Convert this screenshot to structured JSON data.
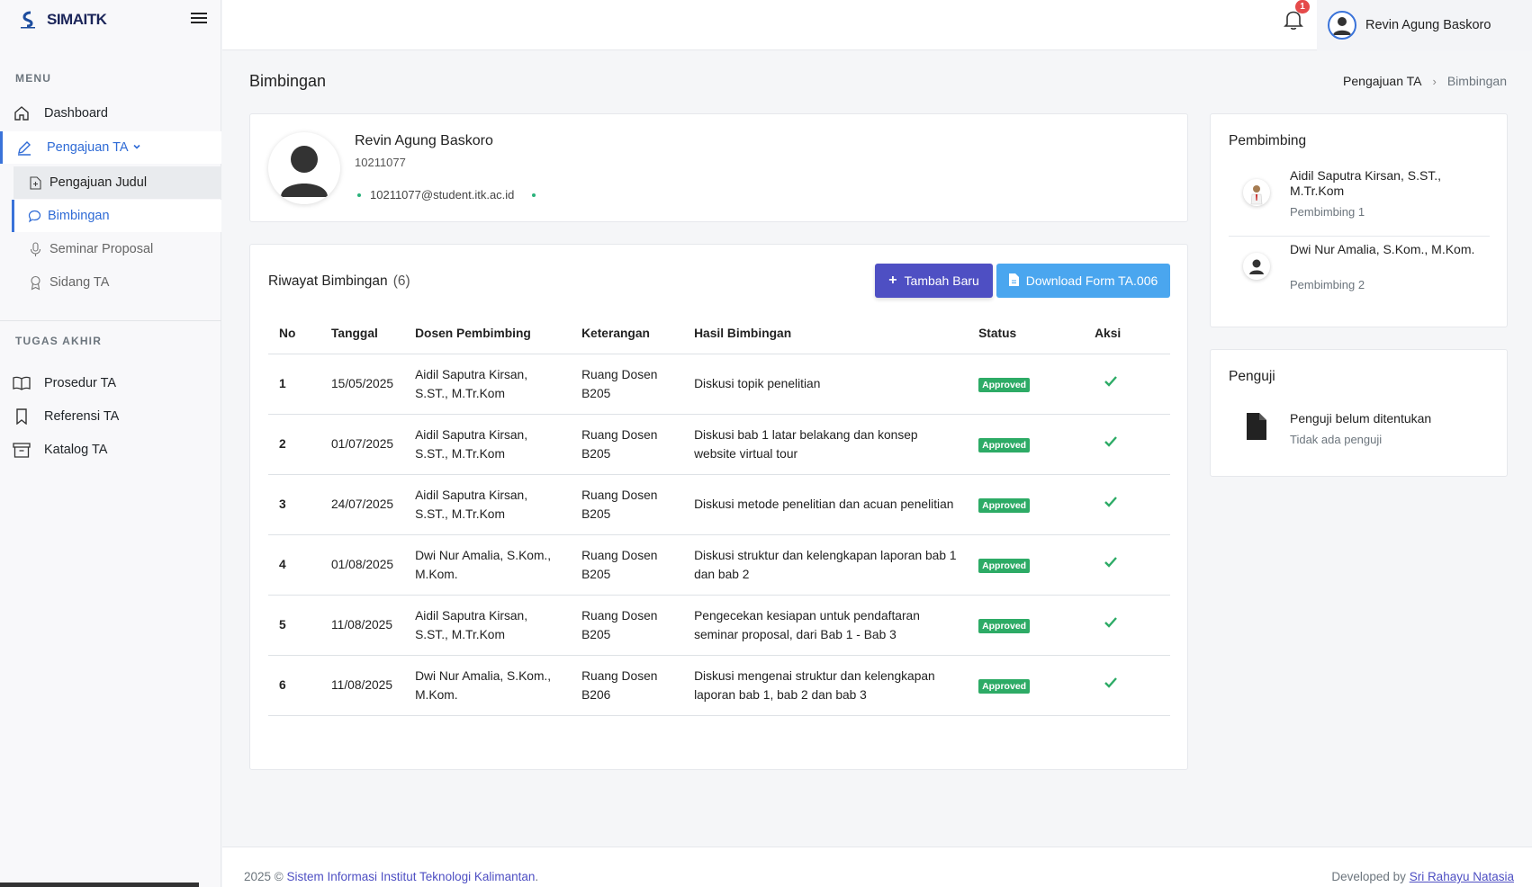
{
  "brand": {
    "name_prefix": "SIMA",
    "name_suffix": "ITK"
  },
  "sidebar": {
    "menu_title": "MENU",
    "items": [
      {
        "label": "Dashboard"
      },
      {
        "label": "Pengajuan TA"
      },
      {
        "label": "Pengajuan Judul"
      },
      {
        "label": "Bimbingan"
      },
      {
        "label": "Seminar Proposal"
      },
      {
        "label": "Sidang TA"
      }
    ],
    "section2_title": "TUGAS AKHIR",
    "items2": [
      {
        "label": "Prosedur TA"
      },
      {
        "label": "Referensi TA"
      },
      {
        "label": "Katalog TA"
      }
    ]
  },
  "topbar": {
    "notification_count": "1",
    "user_name": "Revin Agung Baskoro"
  },
  "page": {
    "title": "Bimbingan",
    "breadcrumb": [
      "Pengajuan TA",
      "Bimbingan"
    ]
  },
  "profile": {
    "name": "Revin Agung Baskoro",
    "nim": "10211077",
    "email": "10211077@student.itk.ac.id"
  },
  "history": {
    "title": "Riwayat Bimbingan",
    "count": "(6)",
    "add_button": "Tambah Baru",
    "download_button": "Download Form TA.006",
    "columns": [
      "No",
      "Tanggal",
      "Dosen Pembimbing",
      "Keterangan",
      "Hasil Bimbingan",
      "Status",
      "Aksi"
    ],
    "rows": [
      {
        "no": "1",
        "tanggal": "15/05/2025",
        "dosen": "Aidil Saputra Kirsan, S.ST., M.Tr.Kom",
        "keterangan": "Ruang Dosen B205",
        "hasil": "Diskusi topik penelitian",
        "status": "Approved"
      },
      {
        "no": "2",
        "tanggal": "01/07/2025",
        "dosen": "Aidil Saputra Kirsan, S.ST., M.Tr.Kom",
        "keterangan": "Ruang Dosen B205",
        "hasil": "Diskusi bab 1 latar belakang dan konsep website virtual tour",
        "status": "Approved"
      },
      {
        "no": "3",
        "tanggal": "24/07/2025",
        "dosen": "Aidil Saputra Kirsan, S.ST., M.Tr.Kom",
        "keterangan": "Ruang Dosen B205",
        "hasil": "Diskusi metode penelitian dan acuan penelitian",
        "status": "Approved"
      },
      {
        "no": "4",
        "tanggal": "01/08/2025",
        "dosen": "Dwi Nur Amalia, S.Kom., M.Kom.",
        "keterangan": "Ruang Dosen B205",
        "hasil": "Diskusi struktur dan kelengkapan laporan bab 1 dan bab 2",
        "status": "Approved"
      },
      {
        "no": "5",
        "tanggal": "11/08/2025",
        "dosen": "Aidil Saputra Kirsan, S.ST., M.Tr.Kom",
        "keterangan": "Ruang Dosen B205",
        "hasil": "Pengecekan kesiapan untuk pendaftaran seminar proposal, dari Bab 1 - Bab 3",
        "status": "Approved"
      },
      {
        "no": "6",
        "tanggal": "11/08/2025",
        "dosen": "Dwi Nur Amalia, S.Kom., M.Kom.",
        "keterangan": "Ruang Dosen B206",
        "hasil": "Diskusi mengenai struktur dan kelengkapan laporan bab 1, bab 2 dan bab 3",
        "status": "Approved"
      }
    ]
  },
  "pembimbing": {
    "title": "Pembimbing",
    "items": [
      {
        "name": "Aidil Saputra Kirsan, S.ST., M.Tr.Kom",
        "role": "Pembimbing 1"
      },
      {
        "name": "Dwi Nur Amalia, S.Kom., M.Kom.",
        "role": "Pembimbing 2"
      }
    ]
  },
  "penguji": {
    "title": "Penguji",
    "name": "Penguji belum ditentukan",
    "note": "Tidak ada penguji"
  },
  "footer": {
    "year": "2025 ©",
    "institution": "Sistem Informasi Institut Teknologi Kalimantan",
    "developed_by": "Developed by",
    "developer": "Sri Rahayu Natasia"
  },
  "colors": {
    "primary": "#4e4fc3",
    "info": "#4aa6ef",
    "success": "#2dab66",
    "active": "#2f6bd6",
    "danger": "#e54b4b"
  }
}
